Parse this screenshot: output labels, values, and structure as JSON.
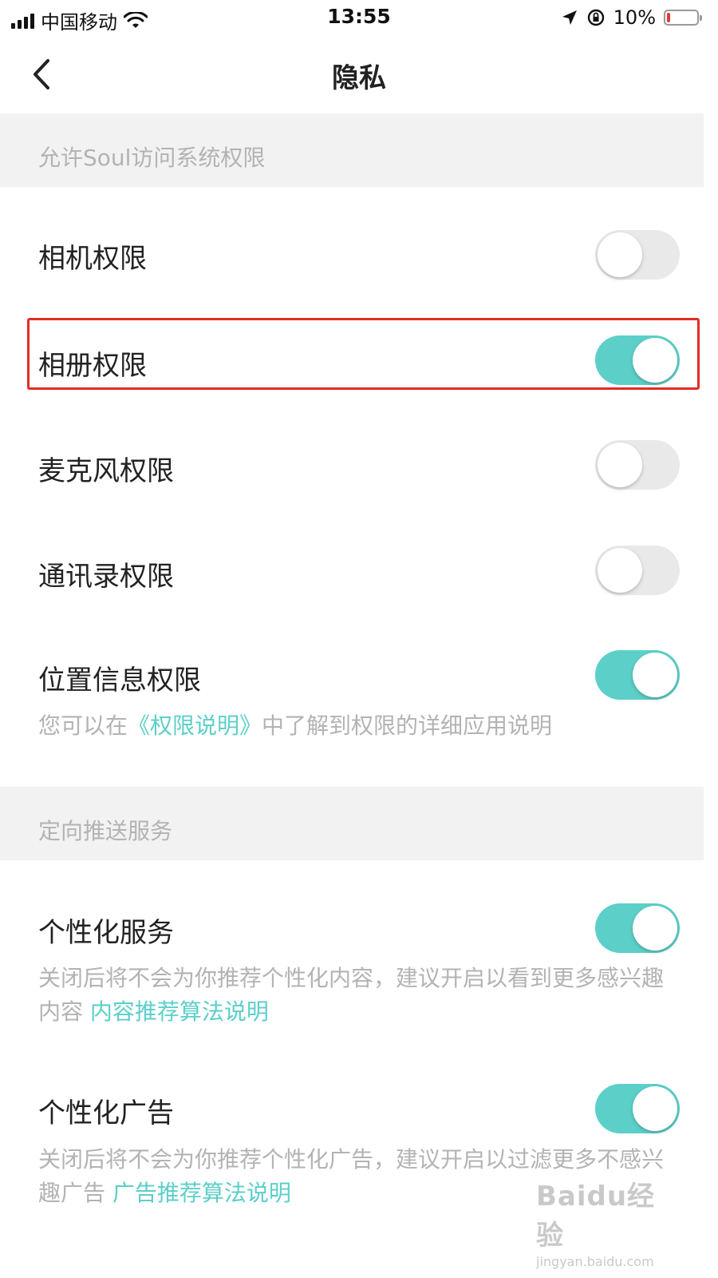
{
  "status_bar": {
    "carrier": "中国移动",
    "time": "13:55",
    "battery": "10%",
    "battery_level_percent": 10,
    "icons": [
      "signal-icon",
      "wifi-icon",
      "location-arrow-icon",
      "rotation-lock-icon",
      "battery-icon"
    ]
  },
  "nav": {
    "title": "隐私",
    "back_icon": "chevron-left-icon"
  },
  "sections": [
    {
      "header": "允许Soul访问系统权限",
      "rows": [
        {
          "label": "相机权限",
          "on": false
        },
        {
          "label": "相册权限",
          "on": true,
          "highlighted": true
        },
        {
          "label": "麦克风权限",
          "on": false
        },
        {
          "label": "通讯录权限",
          "on": false
        },
        {
          "label": "位置信息权限",
          "on": true
        }
      ],
      "footer": {
        "prefix": "您可以在",
        "link": "《权限说明》",
        "suffix": "中了解到权限的详细应用说明"
      }
    },
    {
      "header": "定向推送服务",
      "rows": [
        {
          "label": "个性化服务",
          "on": true,
          "desc": "关闭后将不会为你推荐个性化内容，建议开启以看到更多感兴趣内容",
          "link": "内容推荐算法说明"
        },
        {
          "label": "个性化广告",
          "on": true,
          "desc": "关闭后将不会为你推荐个性化广告，建议开启以过滤更多不感兴趣广告",
          "link": "广告推荐算法说明"
        }
      ]
    }
  ],
  "watermark": {
    "main": "Baidu经验",
    "sub": "jingyan.baidu.com"
  },
  "colors": {
    "accent": "#5ccfc9",
    "toggle_off": "#e9e9ea",
    "section_bg": "#f2f2f3",
    "muted_text": "#b3b3b3",
    "highlight_border": "#e12d25"
  }
}
